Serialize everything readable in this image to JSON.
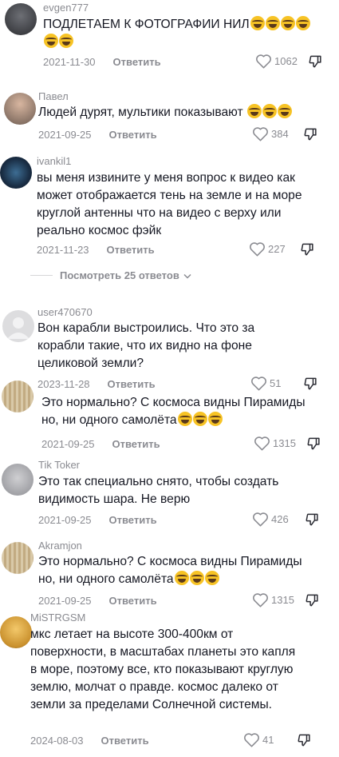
{
  "comments": [
    {
      "username": "evgen777",
      "text": "ПОДЛЕТАЕМ К ФОТОГРАФИИ НИЛ",
      "date": "2021-11-30",
      "likes": "1062"
    },
    {
      "username": "Павел",
      "text": "Людей дурят, мультики показывают",
      "date": "2021-09-25",
      "likes": "384"
    },
    {
      "username": "ivankil1",
      "text": "вы меня извините у меня вопрос к видео как может отображается тень на земле и на море круглой антенны что на видео с верху или реально космос фэйк",
      "date": "2021-11-23",
      "likes": "227",
      "view_replies": "Посмотреть 25 ответов"
    },
    {
      "username": "user470670",
      "text": "Вон карабли выстроились. Что это за корабли такие, что их видно на фоне целиковой земли?",
      "date": "2023-11-28",
      "likes": "51"
    },
    {
      "username": "",
      "text": "Это нормально? С космоса видны Пирамиды но, ни одного самолёта",
      "date": "2021-09-25",
      "likes": "1315"
    },
    {
      "username": "Tik Toker",
      "text": "Это так специально снято, чтобы создать видимость шара. Не верю",
      "date": "2021-09-25",
      "likes": "426"
    },
    {
      "username": "Akramjon",
      "text": "Это нормально? С космоса видны Пирамиды но, ни одного самолёта",
      "date": "2021-09-25",
      "likes": "1315"
    },
    {
      "username": "MiSTRGSM",
      "text": "мкс летает на высоте 300-400км от поверхности, в масштабах планеты это капля в море, поэтому все, кто показывают круглую землю, молчат о правде. космос далеко от земли за пределами Солнечной системы.",
      "date": "2024-08-03",
      "likes": "41"
    }
  ],
  "reply_label": "Ответить",
  "icons": {
    "like": "heart-icon",
    "dislike": "dislike-icon",
    "chevron": "chevron-down-icon",
    "emoji": "laughing-emoji-icon"
  }
}
